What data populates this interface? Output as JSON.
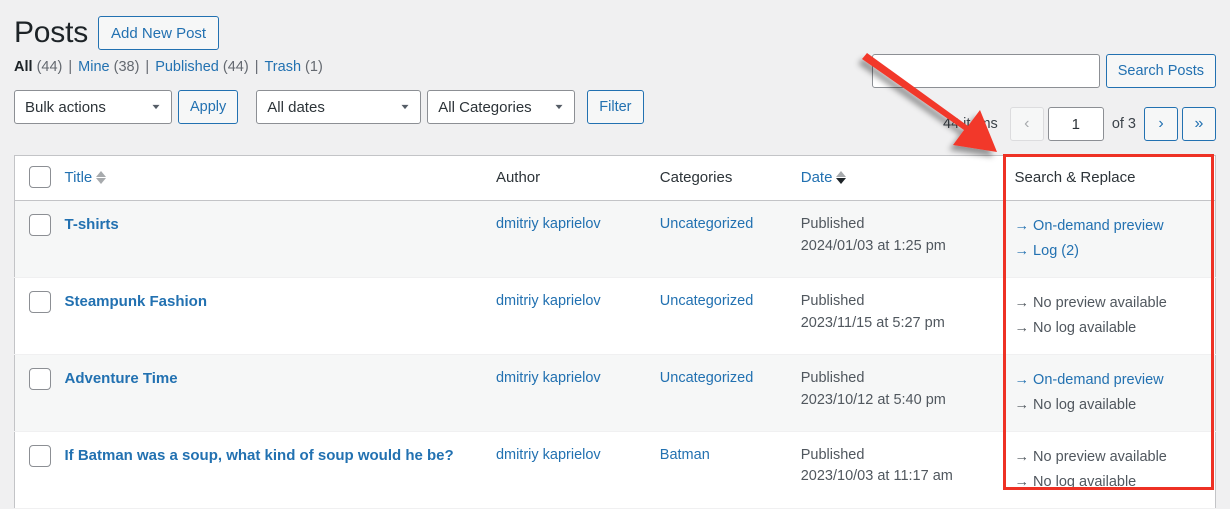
{
  "header": {
    "title": "Posts",
    "add_new_label": "Add New Post"
  },
  "filters": {
    "items": [
      {
        "label": "All",
        "count": "(44)",
        "current": true
      },
      {
        "label": "Mine",
        "count": "(38)",
        "current": false
      },
      {
        "label": "Published",
        "count": "(44)",
        "current": false
      },
      {
        "label": "Trash",
        "count": "(1)",
        "current": false
      }
    ],
    "separator": "|"
  },
  "toolbar": {
    "bulk_actions_value": "Bulk actions",
    "apply_label": "Apply",
    "all_dates_value": "All dates",
    "all_categories_value": "All Categories",
    "filter_label": "Filter"
  },
  "search": {
    "value": "",
    "placeholder": "",
    "button_label": "Search Posts"
  },
  "pagination": {
    "items_label": "44 items",
    "prev_icon": "‹",
    "first_icon": "«",
    "next_icon": "›",
    "last_icon": "»",
    "current_page": "1",
    "of_total": "of 3"
  },
  "table": {
    "columns": {
      "title": "Title",
      "author": "Author",
      "categories": "Categories",
      "date": "Date",
      "search_replace": "Search & Replace"
    },
    "rows": [
      {
        "title": "T-shirts",
        "author": "dmitriy kaprielov",
        "category": "Uncategorized",
        "date_status": "Published",
        "date_value": "2024/01/03 at 1:25 pm",
        "preview_label": "→ On-demand preview",
        "preview_is_link": true,
        "log_label": "→ Log (2)",
        "log_is_link": true
      },
      {
        "title": "Steampunk Fashion",
        "author": "dmitriy kaprielov",
        "category": "Uncategorized",
        "date_status": "Published",
        "date_value": "2023/11/15 at 5:27 pm",
        "preview_label": "→ No preview available",
        "preview_is_link": false,
        "log_label": "→ No log available",
        "log_is_link": false
      },
      {
        "title": "Adventure Time",
        "author": "dmitriy kaprielov",
        "category": "Uncategorized",
        "date_status": "Published",
        "date_value": "2023/10/12 at 5:40 pm",
        "preview_label": "→ On-demand preview",
        "preview_is_link": true,
        "log_label": "→ No log available",
        "log_is_link": false
      },
      {
        "title": "If Batman was a soup, what kind of soup would he be?",
        "author": "dmitriy kaprielov",
        "category": "Batman",
        "date_status": "Published",
        "date_value": "2023/10/03 at 11:17 am",
        "preview_label": "→ No preview available",
        "preview_is_link": false,
        "log_label": "→ No log available",
        "log_is_link": false
      }
    ]
  },
  "annotations": {
    "highlight_color": "#ee3124",
    "arrow_color": "#f2372c"
  }
}
